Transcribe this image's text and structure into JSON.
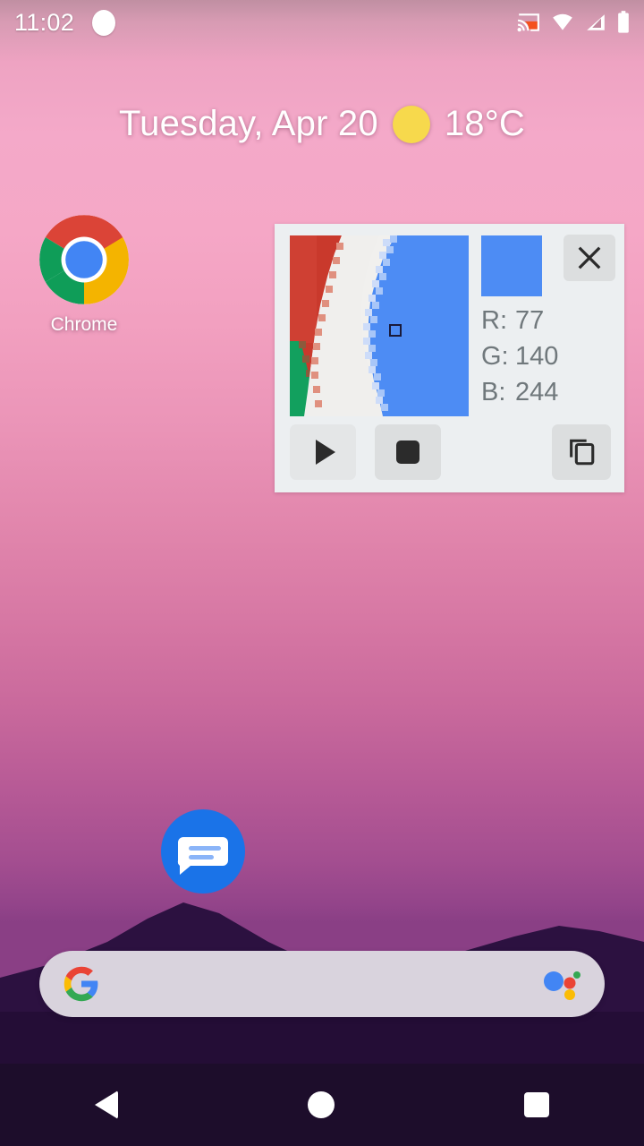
{
  "status_bar": {
    "time": "11:02",
    "icons": [
      "notification-dot",
      "cast-icon",
      "wifi-icon",
      "signal-icon",
      "battery-icon"
    ]
  },
  "date_widget": {
    "date": "Tuesday, Apr 20",
    "weather_icon": "sun-icon",
    "temperature": "18°C"
  },
  "apps": [
    {
      "name": "chrome",
      "label": "Chrome",
      "icon": "chrome-icon"
    },
    {
      "name": "messages",
      "label": "",
      "icon": "messages-icon"
    }
  ],
  "color_picker": {
    "magnifier_label": "magnified-pixel-preview",
    "cursor_label": "pixel-cursor",
    "swatch_color": "#4d8cf4",
    "close_label": "×",
    "channels": [
      {
        "key": "R:",
        "value": "77"
      },
      {
        "key": "G:",
        "value": "140"
      },
      {
        "key": "B:",
        "value": "244"
      }
    ],
    "controls": [
      {
        "name": "play-button",
        "icon": "play-icon",
        "label": ""
      },
      {
        "name": "stop-button",
        "icon": "stop-icon",
        "label": ""
      },
      {
        "name": "copy-button",
        "icon": "copy-icon",
        "label": ""
      }
    ]
  },
  "search_bar": {
    "placeholder": "",
    "left_icon": "google-g-icon",
    "right_icon": "google-assistant-icon"
  },
  "nav_bar": {
    "back": "back-icon",
    "home": "home-icon",
    "recents": "recents-icon"
  },
  "colors": {
    "picker_bg": "#eceff1",
    "swatch": "#4d8cf4",
    "chrome_red": "#db4437",
    "chrome_green": "#0f9d58",
    "chrome_yellow": "#f4b400",
    "chrome_blue": "#4285f4",
    "messages_blue": "#1a73e8",
    "nav_bg": "#1d0d2b"
  }
}
